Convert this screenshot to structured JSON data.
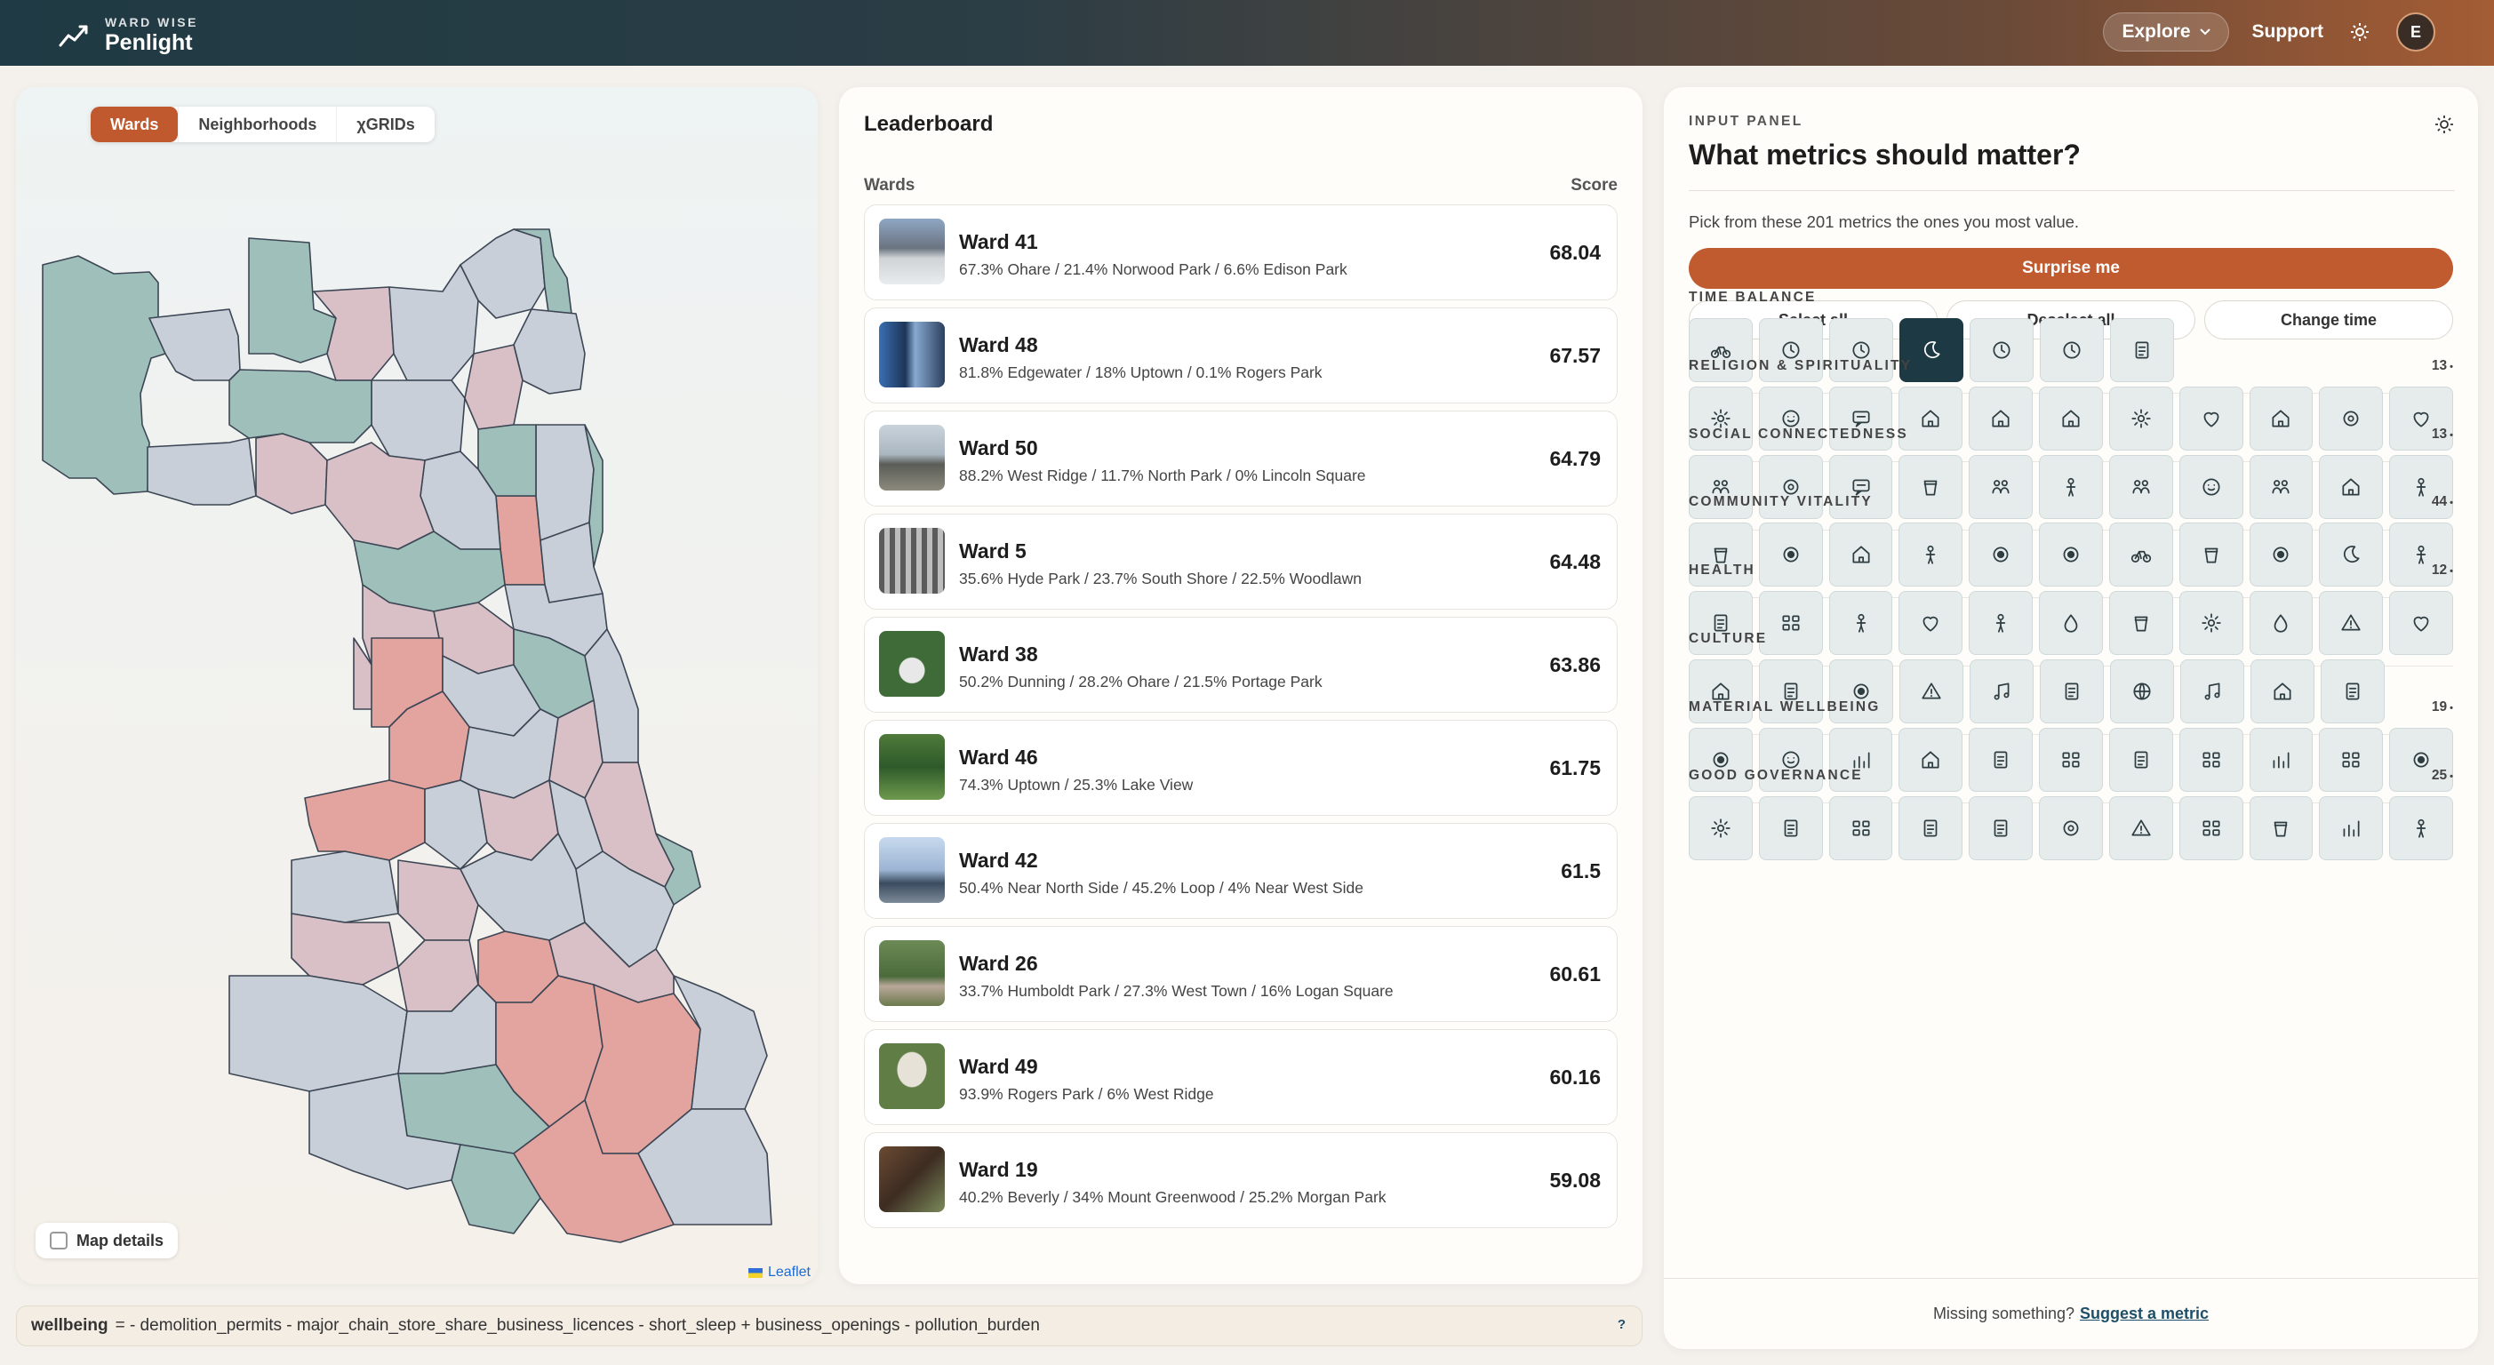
{
  "header": {
    "brand_small": "WARD WISE",
    "brand_big": "Penlight",
    "explore_label": "Explore",
    "support_label": "Support",
    "avatar_initial": "E"
  },
  "map": {
    "tabs": [
      "Wards",
      "Neighborhoods",
      "χGRIDs"
    ],
    "active_tab": "Wards",
    "map_details_label": "Map details",
    "attribution": "Leaflet",
    "colors": {
      "teal": "#9fbfba",
      "slate": "#c8cfd8",
      "pink": "#d9bfc6",
      "red": "#e3a39f",
      "border": "#3c4654"
    }
  },
  "leaderboard": {
    "title": "Leaderboard",
    "col_wards": "Wards",
    "col_score": "Score",
    "rows": [
      {
        "name": "Ward 41",
        "sub": "67.3% Ohare / 21.4% Norwood Park / 6.6% Edison Park",
        "score": "68.04"
      },
      {
        "name": "Ward 48",
        "sub": "81.8% Edgewater / 18% Uptown / 0.1% Rogers Park",
        "score": "67.57"
      },
      {
        "name": "Ward 50",
        "sub": "88.2% West Ridge / 11.7% North Park / 0% Lincoln Square",
        "score": "64.79"
      },
      {
        "name": "Ward 5",
        "sub": "35.6% Hyde Park / 23.7% South Shore / 22.5% Woodlawn",
        "score": "64.48"
      },
      {
        "name": "Ward 38",
        "sub": "50.2% Dunning / 28.2% Ohare / 21.5% Portage Park",
        "score": "63.86"
      },
      {
        "name": "Ward 46",
        "sub": "74.3% Uptown / 25.3% Lake View",
        "score": "61.75"
      },
      {
        "name": "Ward 42",
        "sub": "50.4% Near North Side / 45.2% Loop / 4% Near West Side",
        "score": "61.5"
      },
      {
        "name": "Ward 26",
        "sub": "33.7% Humboldt Park / 27.3% West Town / 16% Logan Square",
        "score": "60.61"
      },
      {
        "name": "Ward 49",
        "sub": "93.9% Rogers Park / 6% West Ridge",
        "score": "60.16"
      },
      {
        "name": "Ward 19",
        "sub": "40.2% Beverly / 34% Mount Greenwood / 25.2% Morgan Park",
        "score": "59.08"
      }
    ]
  },
  "input_panel": {
    "kicker": "INPUT PANEL",
    "title": "What metrics should matter?",
    "description": "Pick from these 201 metrics the ones you most value.",
    "surprise_label": "Surprise me",
    "select_all": "Select all",
    "deselect_all": "Deselect all",
    "change_time": "Change time",
    "footer_text": "Missing something?",
    "footer_link": "Suggest a metric",
    "categories": [
      {
        "name": "TIME BALANCE",
        "count": "",
        "icons": [
          "bike-icon",
          "clock-icon",
          "clock-icon",
          "moon-icon",
          "hourglass-icon",
          "stopwatch-icon",
          "bus-icon"
        ],
        "selected_index": 3
      },
      {
        "name": "RELIGION & SPIRITUALITY",
        "count": "13",
        "icons": [
          "sun-icon",
          "smile-icon",
          "chat-icon",
          "home-icon",
          "house-icon",
          "house-plus-icon",
          "sparkles-icon",
          "heart-circle-icon",
          "temple-icon",
          "wave-icon",
          "heart-icon"
        ]
      },
      {
        "name": "SOCIAL CONNECTEDNESS",
        "count": "13",
        "icons": [
          "people-icon",
          "network-icon",
          "megaphone-icon",
          "cup-icon",
          "group-icon",
          "user-x-icon",
          "users-icon",
          "smile-icon",
          "people-icon",
          "house-icon",
          "person-icon"
        ]
      },
      {
        "name": "COMMUNITY VITALITY",
        "count": "44",
        "icons": [
          "cocktail-icon",
          "target-icon",
          "house-icon",
          "utensils-icon",
          "target-icon",
          "target-icon",
          "bike-icon",
          "trash-icon",
          "target-icon",
          "moon-icon",
          "person-icon"
        ]
      },
      {
        "name": "HEALTH",
        "count": "12",
        "icons": [
          "bed-icon",
          "dumbbell-icon",
          "person-icon",
          "heart-icon",
          "person-icon",
          "drop-icon",
          "cart-icon",
          "umbrella-icon",
          "flame-icon",
          "warning-icon",
          "heart-icon"
        ]
      },
      {
        "name": "CULTURE",
        "count": "",
        "icons": [
          "building-icon",
          "board-icon",
          "award-icon",
          "monument-icon",
          "music-icon",
          "document-icon",
          "globe-icon",
          "music-note-icon",
          "museum-icon",
          "screen-icon"
        ]
      },
      {
        "name": "MATERIAL WELLBEING",
        "count": "19",
        "icons": [
          "target-icon",
          "smile-icon",
          "chart-icon",
          "home-icon",
          "tag-icon",
          "calendar-icon",
          "receipt-icon",
          "stack-icon",
          "money-icon",
          "safe-icon",
          "target-icon"
        ]
      },
      {
        "name": "GOOD GOVERNANCE",
        "count": "25",
        "icons": [
          "sun-icon",
          "board-icon",
          "grid-icon",
          "briefcase-icon",
          "document-icon",
          "route-icon",
          "tower-icon",
          "grid-icon",
          "car-icon",
          "trend-icon",
          "person-icon"
        ]
      }
    ]
  },
  "formula": {
    "label": "wellbeing",
    "expression": "= - demolition_permits - major_chain_store_share_business_licences - short_sleep + business_openings - pollution_burden",
    "help": "?"
  }
}
